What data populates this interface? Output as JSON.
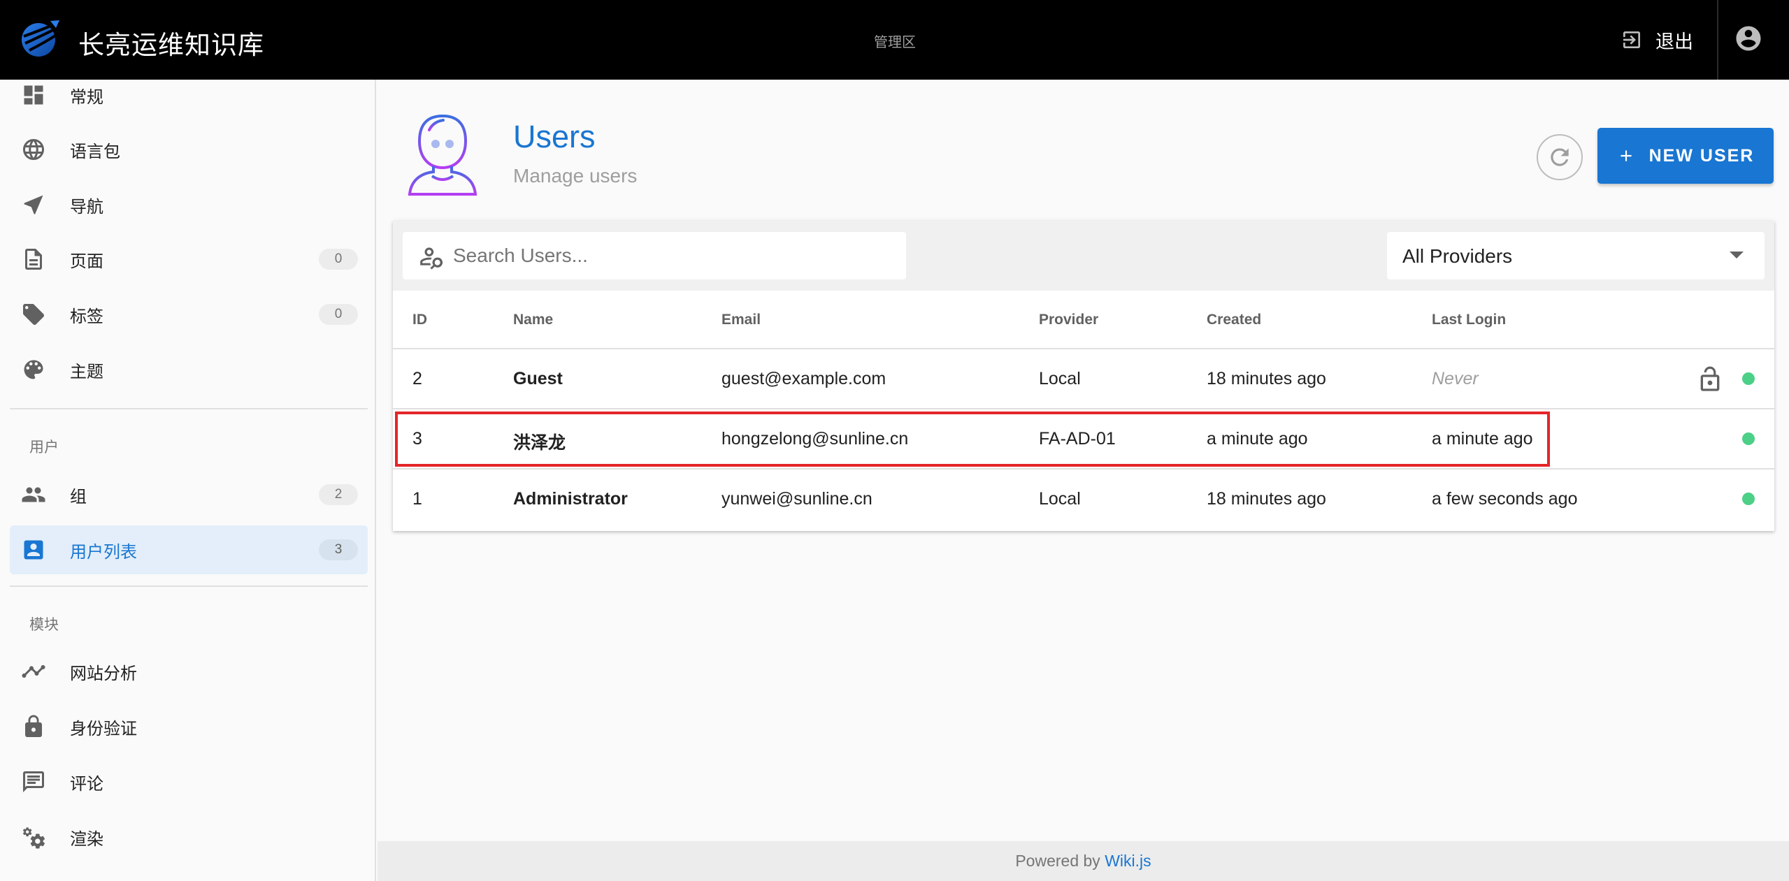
{
  "header": {
    "brand": "长亮运维知识库",
    "area_label": "管理区",
    "logout_label": "退出"
  },
  "sidebar": {
    "items_top": [
      {
        "label": "常规",
        "icon": "dashboard-icon"
      },
      {
        "label": "语言包",
        "icon": "globe-icon"
      },
      {
        "label": "导航",
        "icon": "navigation-icon"
      },
      {
        "label": "页面",
        "icon": "page-icon",
        "count": "0"
      },
      {
        "label": "标签",
        "icon": "tags-icon",
        "count": "0"
      },
      {
        "label": "主题",
        "icon": "palette-icon"
      }
    ],
    "section_users": "用户",
    "items_users": [
      {
        "label": "组",
        "icon": "group-icon",
        "count": "2"
      },
      {
        "label": "用户列表",
        "icon": "user-card-icon",
        "count": "3",
        "active": true
      }
    ],
    "section_modules": "模块",
    "items_modules": [
      {
        "label": "网站分析",
        "icon": "analytics-icon"
      },
      {
        "label": "身份验证",
        "icon": "lock-icon"
      },
      {
        "label": "评论",
        "icon": "comment-icon"
      },
      {
        "label": "渲染",
        "icon": "cogs-icon"
      }
    ]
  },
  "page": {
    "title": "Users",
    "subtitle": "Manage users",
    "new_user_label": "NEW USER"
  },
  "toolbar": {
    "search_placeholder": "Search Users...",
    "provider_value": "All Providers"
  },
  "table": {
    "columns": [
      "ID",
      "Name",
      "Email",
      "Provider",
      "Created",
      "Last Login"
    ],
    "rows": [
      {
        "id": "2",
        "name": "Guest",
        "email": "guest@example.com",
        "provider": "Local",
        "created": "18 minutes ago",
        "last_login": "Never",
        "locked": true
      },
      {
        "id": "3",
        "name": "洪泽龙",
        "email": "hongzelong@sunline.cn",
        "provider": "FA-AD-01",
        "created": "a minute ago",
        "last_login": "a minute ago",
        "highlighted": true
      },
      {
        "id": "1",
        "name": "Administrator",
        "email": "yunwei@sunline.cn",
        "provider": "Local",
        "created": "18 minutes ago",
        "last_login": "a few seconds ago"
      }
    ]
  },
  "footer": {
    "prefix": "Powered by",
    "link": "Wiki.js"
  },
  "colors": {
    "accent": "#1976d2",
    "status_active": "#4cd087",
    "highlight_border": "#e3262a"
  }
}
